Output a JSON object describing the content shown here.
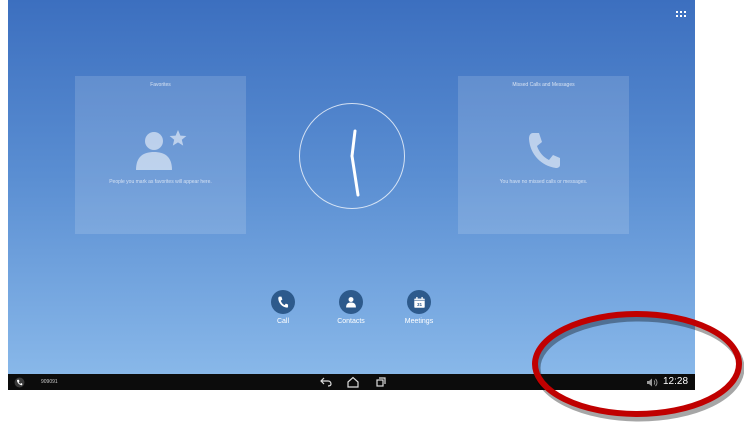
{
  "favorites": {
    "title": "Favorites",
    "empty_text": "People you mark as favorites will appear here.",
    "icon": "person-star-icon"
  },
  "missed": {
    "title": "Missed Calls and Messages",
    "empty_text": "You have no missed calls or messages.",
    "icon": "phone-icon"
  },
  "actions": [
    {
      "label": "Call",
      "icon": "phone-icon"
    },
    {
      "label": "Contacts",
      "icon": "person-icon"
    },
    {
      "label": "Meetings",
      "icon": "calendar-icon"
    }
  ],
  "meetings_calendar_day": "31",
  "statusbar": {
    "number": "909091",
    "time": "12:28"
  },
  "colors": {
    "background_top": "#3c6fbf",
    "background_bottom": "#8cbbeb",
    "action_circle": "#2d5a8c",
    "statusbar": "#0c0c0c",
    "annotation": "#c00000"
  }
}
